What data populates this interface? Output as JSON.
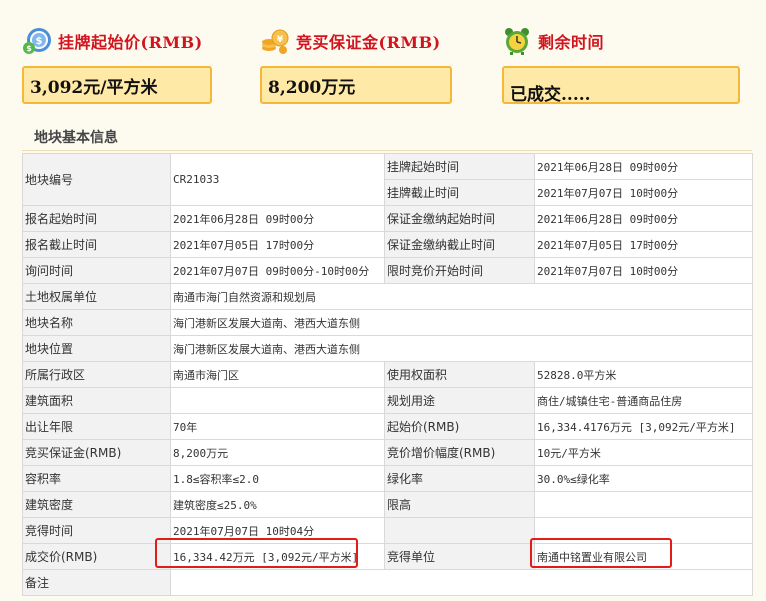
{
  "top_cards": [
    {
      "title": "挂牌起始价(RMB)",
      "value": "3,092元/平方米",
      "icon": "price-tag-icon"
    },
    {
      "title": "竞买保证金(RMB)",
      "value": "8,200万元",
      "icon": "coin-stack-icon"
    },
    {
      "title": "剩余时间",
      "value": "已成交.....",
      "icon": "alarm-clock-icon"
    }
  ],
  "section_title": "地块基本信息",
  "table": {
    "r1": {
      "l1": "地块编号",
      "v1": "CR21033",
      "l2": "挂牌起始时间",
      "v2": "2021年06月28日 09时00分"
    },
    "r2": {
      "l2": "挂牌截止时间",
      "v2": "2021年07月07日 10时00分"
    },
    "r3": {
      "l1": "报名起始时间",
      "v1": "2021年06月28日 09时00分",
      "l2": "保证金缴纳起始时间",
      "v2": "2021年06月28日 09时00分"
    },
    "r4": {
      "l1": "报名截止时间",
      "v1": "2021年07月05日 17时00分",
      "l2": "保证金缴纳截止时间",
      "v2": "2021年07月05日 17时00分"
    },
    "r5": {
      "l1": "询问时间",
      "v1": "2021年07月07日 09时00分-10时00分",
      "l2": "限时竞价开始时间",
      "v2": "2021年07月07日 10时00分"
    },
    "r6": {
      "l1": "土地权属单位",
      "v1": "南通市海门自然资源和规划局"
    },
    "r7": {
      "l1": "地块名称",
      "v1": "海门港新区发展大道南、港西大道东侧"
    },
    "r8": {
      "l1": "地块位置",
      "v1": "海门港新区发展大道南、港西大道东侧"
    },
    "r9": {
      "l1": "所属行政区",
      "v1": "南通市海门区",
      "l2": "使用权面积",
      "v2": "52828.0平方米"
    },
    "r10": {
      "l1": "建筑面积",
      "v1": "",
      "l2": "规划用途",
      "v2": "商住/城镇住宅-普通商品住房"
    },
    "r11": {
      "l1": "出让年限",
      "v1": "70年",
      "l2": "起始价(RMB)",
      "v2": "16,334.4176万元 [3,092元/平方米]"
    },
    "r12": {
      "l1": "竞买保证金(RMB)",
      "v1": "8,200万元",
      "l2": "竞价增价幅度(RMB)",
      "v2": "10元/平方米"
    },
    "r13": {
      "l1": "容积率",
      "v1": "1.8≤容积率≤2.0",
      "l2": "绿化率",
      "v2": "30.0%≤绿化率"
    },
    "r14": {
      "l1": "建筑密度",
      "v1": "建筑密度≤25.0%",
      "l2": "限高",
      "v2": ""
    },
    "r15": {
      "l1": "竞得时间",
      "v1": "2021年07月07日 10时04分"
    },
    "r16": {
      "l1": "成交价(RMB)",
      "v1": "16,334.42万元 [3,092元/平方米]",
      "l2": "竞得单位",
      "v2": "南通中铭置业有限公司"
    },
    "r17": {
      "l1": "备注",
      "v1": ""
    }
  },
  "colors": {
    "title_red": "#d2141e",
    "box_fill": "#ffe9a6",
    "box_border": "#f4b73a",
    "highlight": "#e41b17"
  }
}
